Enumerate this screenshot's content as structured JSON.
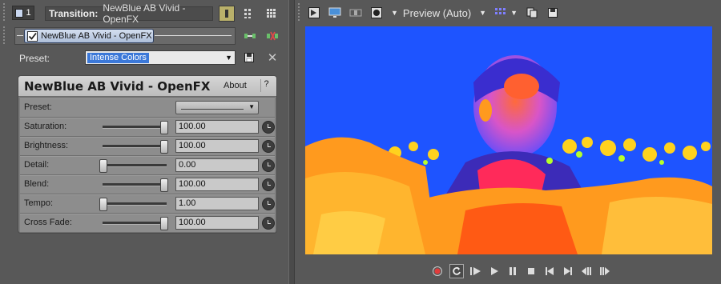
{
  "left_panel": {
    "track_badge": "1",
    "transition_label": "Transition:",
    "transition_name": "NewBlue AB Vivid - OpenFX",
    "chain_chip_label": "NewBlue AB Vivid - OpenFX",
    "preset_label": "Preset:",
    "preset_value": "Intense Colors",
    "plugin": {
      "title": "NewBlue AB Vivid - OpenFX",
      "about_label": "About",
      "help_label": "?",
      "preset_row_label": "Preset:",
      "params": [
        {
          "label": "Saturation:",
          "value": "100.00",
          "level": 1.0
        },
        {
          "label": "Brightness:",
          "value": "100.00",
          "level": 1.0
        },
        {
          "label": "Detail:",
          "value": "0.00",
          "level": 0.0
        },
        {
          "label": "Blend:",
          "value": "100.00",
          "level": 1.0
        },
        {
          "label": "Tempo:",
          "value": "1.00",
          "level": 0.0
        },
        {
          "label": "Cross Fade:",
          "value": "100.00",
          "level": 1.0
        }
      ]
    }
  },
  "right_panel": {
    "preview_mode": "Preview (Auto)"
  },
  "colors": {
    "panel_bg": "#585858",
    "preset_highlight": "#3b78d8",
    "video_blue": "#1e54ff",
    "video_orange": "#ff9a1e",
    "record_red": "#e33b3b"
  }
}
